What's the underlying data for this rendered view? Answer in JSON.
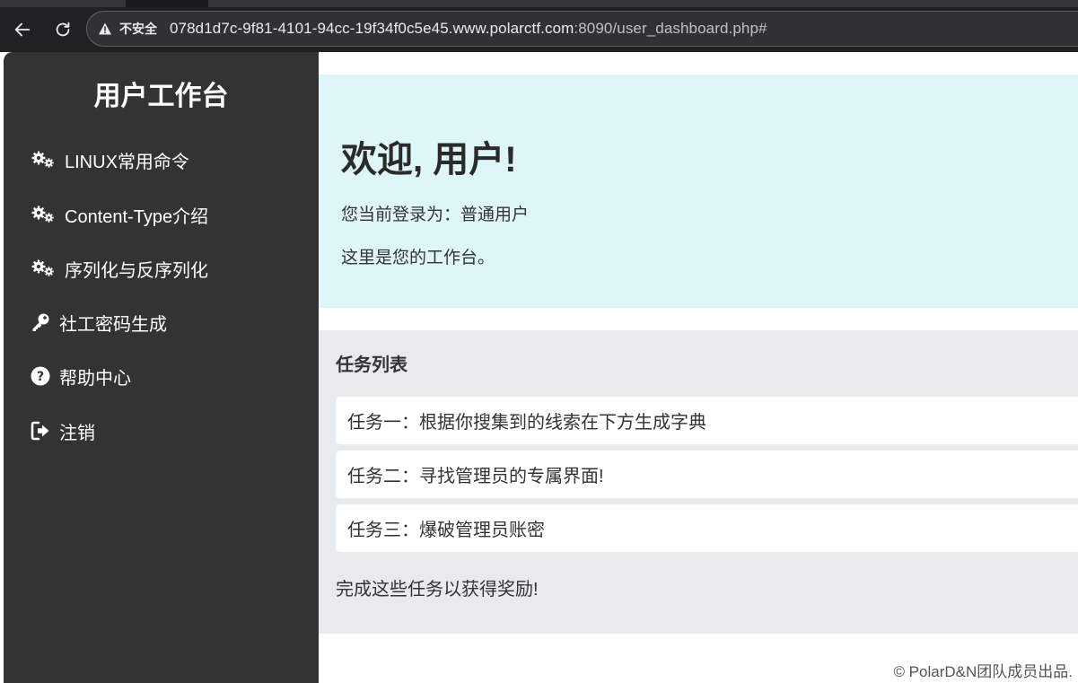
{
  "browser": {
    "insecure_label": "不安全",
    "url_host": "078d1d7c-9f81-4101-94cc-19f34f0c5e45.www.polarctf.com",
    "url_path": ":8090/user_dashboard.php#"
  },
  "sidebar": {
    "title": "用户工作台",
    "items": [
      {
        "label": "LINUX常用命令",
        "icon": "cogs-icon"
      },
      {
        "label": "Content-Type介绍",
        "icon": "cogs-icon"
      },
      {
        "label": "序列化与反序列化",
        "icon": "cogs-icon"
      },
      {
        "label": "社工密码生成",
        "icon": "key-icon"
      },
      {
        "label": "帮助中心",
        "icon": "question-circle-icon"
      },
      {
        "label": "注销",
        "icon": "sign-out-icon"
      }
    ]
  },
  "welcome": {
    "heading": "欢迎, 用户!",
    "login_status": "您当前登录为：普通用户",
    "description": "这里是您的工作台。"
  },
  "tasks": {
    "title": "任务列表",
    "items": [
      "任务一：根据你搜集到的线索在下方生成字典",
      "任务二：寻找管理员的专属界面!",
      "任务三：爆破管理员账密"
    ],
    "footer": "完成这些任务以获得奖励!"
  },
  "footer": {
    "copyright": "© PolarD&N团队成员出品."
  },
  "colors": {
    "sidebar_bg": "#333333",
    "welcome_bg": "#dff6f8",
    "tasks_bg": "#e8ebee"
  }
}
